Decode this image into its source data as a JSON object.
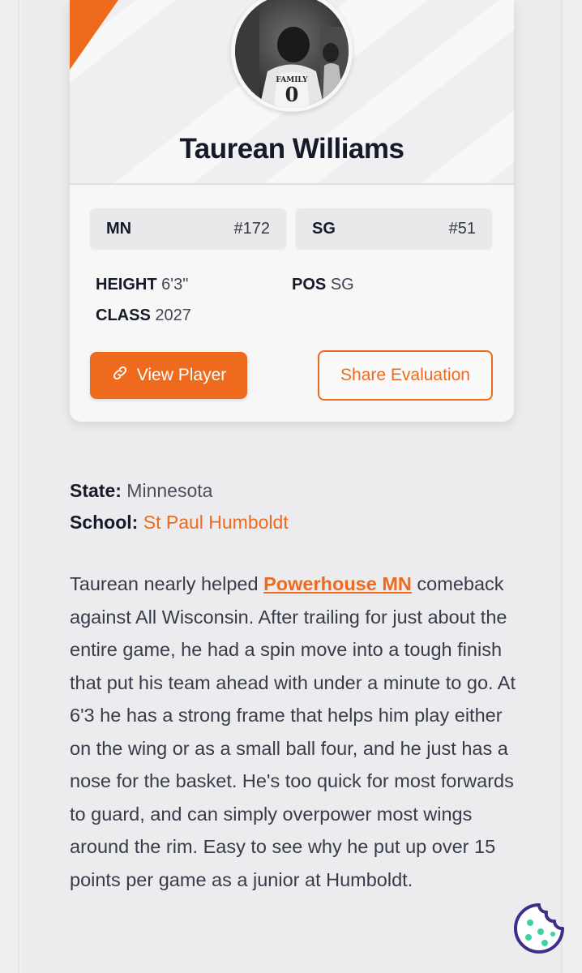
{
  "player": {
    "name": "Taurean Williams",
    "state_abbr": "MN",
    "state_rank": "#172",
    "position_abbr": "SG",
    "position_rank": "#51",
    "height_label": "HEIGHT",
    "height": "6'3\"",
    "pos_label": "POS",
    "pos": "SG",
    "class_label": "CLASS",
    "class": "2027",
    "jersey_text": "FAMILY",
    "jersey_number": "0"
  },
  "buttons": {
    "view_player": "View Player",
    "share_evaluation": "Share Evaluation"
  },
  "info": {
    "state_label": "State:",
    "state": "Minnesota",
    "school_label": "School:",
    "school": "St Paul Humboldt"
  },
  "evaluation": {
    "before_link": "Taurean nearly helped ",
    "link_text": "Powerhouse MN",
    "after_link": " comeback against All Wisconsin. After trailing for just about the entire game, he had a spin move into a tough finish that put his team ahead with under a minute to go. At 6'3 he has a strong frame that helps him play either on the wing or as a small ball four, and he just has a nose for the basket. He's too quick for most forwards to guard, and can simply overpower most wings around the rim. Easy to see why he put up over 15 points per game as a junior at Humboldt."
  },
  "colors": {
    "accent": "#ee6a1d",
    "cookie": "#3c2f87",
    "cookie_dots": "#3fd1a0"
  },
  "icons": {
    "view_player": "link-icon",
    "cookie": "cookie-icon"
  }
}
